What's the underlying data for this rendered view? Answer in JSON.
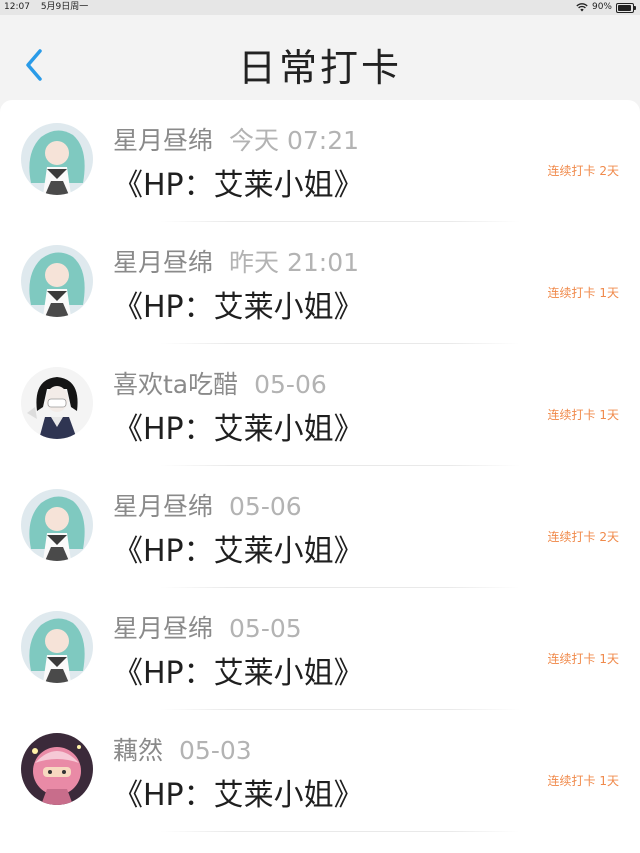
{
  "status_bar": {
    "time": "12:07",
    "date": "5月9日周一",
    "battery": "90%",
    "battery_level": 0.9
  },
  "header": {
    "title": "日常打卡",
    "back_icon": "chevron-left-icon",
    "accent_color": "#2a9be8"
  },
  "entries": [
    {
      "user": "星月昼绵",
      "time": "今天 07:21",
      "book": "《HP：艾莱小姐》",
      "streak": "连续打卡 2天",
      "avatar": "teal-hair-avatar"
    },
    {
      "user": "星月昼绵",
      "time": "昨天 21:01",
      "book": "《HP：艾莱小姐》",
      "streak": "连续打卡 1天",
      "avatar": "teal-hair-avatar"
    },
    {
      "user": "喜欢ta吃醋",
      "time": "05-06",
      "book": "《HP：艾莱小姐》",
      "streak": "连续打卡 1天",
      "avatar": "dark-hair-mask-avatar"
    },
    {
      "user": "星月昼绵",
      "time": "05-06",
      "book": "《HP：艾莱小姐》",
      "streak": "连续打卡 2天",
      "avatar": "teal-hair-avatar"
    },
    {
      "user": "星月昼绵",
      "time": "05-05",
      "book": "《HP：艾莱小姐》",
      "streak": "连续打卡 1天",
      "avatar": "teal-hair-avatar"
    },
    {
      "user": "藕然",
      "time": "05-03",
      "book": "《HP：艾莱小姐》",
      "streak": "连续打卡 1天",
      "avatar": "pink-character-avatar"
    }
  ],
  "colors": {
    "streak": "#f08a4b",
    "name": "#8a8a8a",
    "time": "#b3b3b3"
  }
}
